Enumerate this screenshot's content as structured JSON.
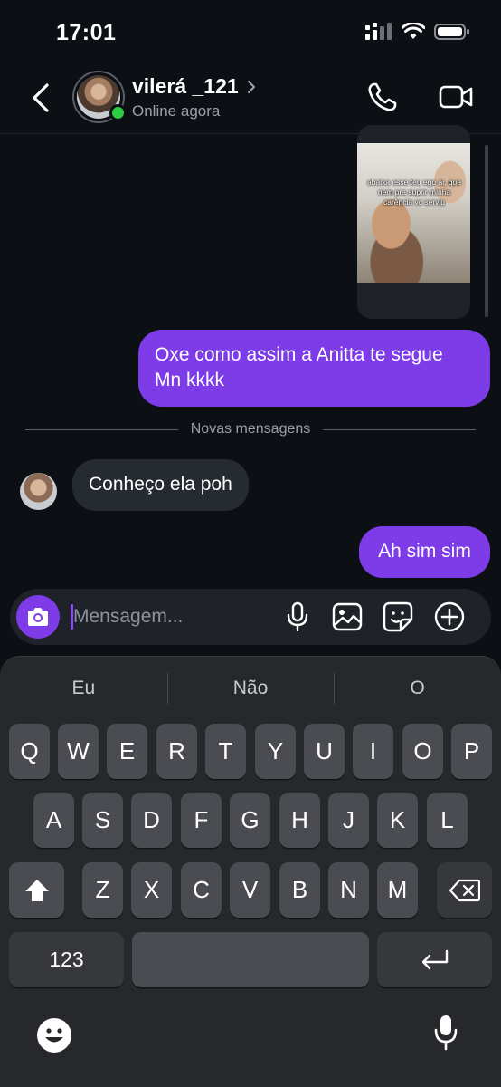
{
  "status_bar": {
    "time": "17:01"
  },
  "header": {
    "contact_name": "vilerá _121",
    "contact_status": "Online agora"
  },
  "messages": {
    "media_caption": "abaixa esse teu ego ai, que nem pra suprir minha carência vc serviu",
    "outgoing_1": "Oxe como assim a Anitta te segue Mn kkkk",
    "divider": "Novas mensagens",
    "incoming_1": "Conheço  ela poh",
    "outgoing_2": "Ah sim sim"
  },
  "composer": {
    "placeholder": "Mensagem..."
  },
  "keyboard": {
    "suggestions": [
      "Eu",
      "Não",
      "O"
    ],
    "row1": [
      "Q",
      "W",
      "E",
      "R",
      "T",
      "Y",
      "U",
      "I",
      "O",
      "P"
    ],
    "row2": [
      "A",
      "S",
      "D",
      "F",
      "G",
      "H",
      "J",
      "K",
      "L"
    ],
    "row3": [
      "Z",
      "X",
      "C",
      "V",
      "B",
      "N",
      "M"
    ],
    "numbers_key": "123"
  },
  "colors": {
    "accent": "#7d3ce8",
    "online": "#2ecc40",
    "background": "#0c0f14",
    "incoming_bubble": "#262a31"
  },
  "icons": {
    "back": "chevron-left-icon",
    "call": "phone-icon",
    "video": "video-camera-icon",
    "camera": "camera-icon",
    "mic": "microphone-icon",
    "gallery": "image-icon",
    "sticker": "sticker-icon",
    "add": "plus-circle-icon"
  }
}
